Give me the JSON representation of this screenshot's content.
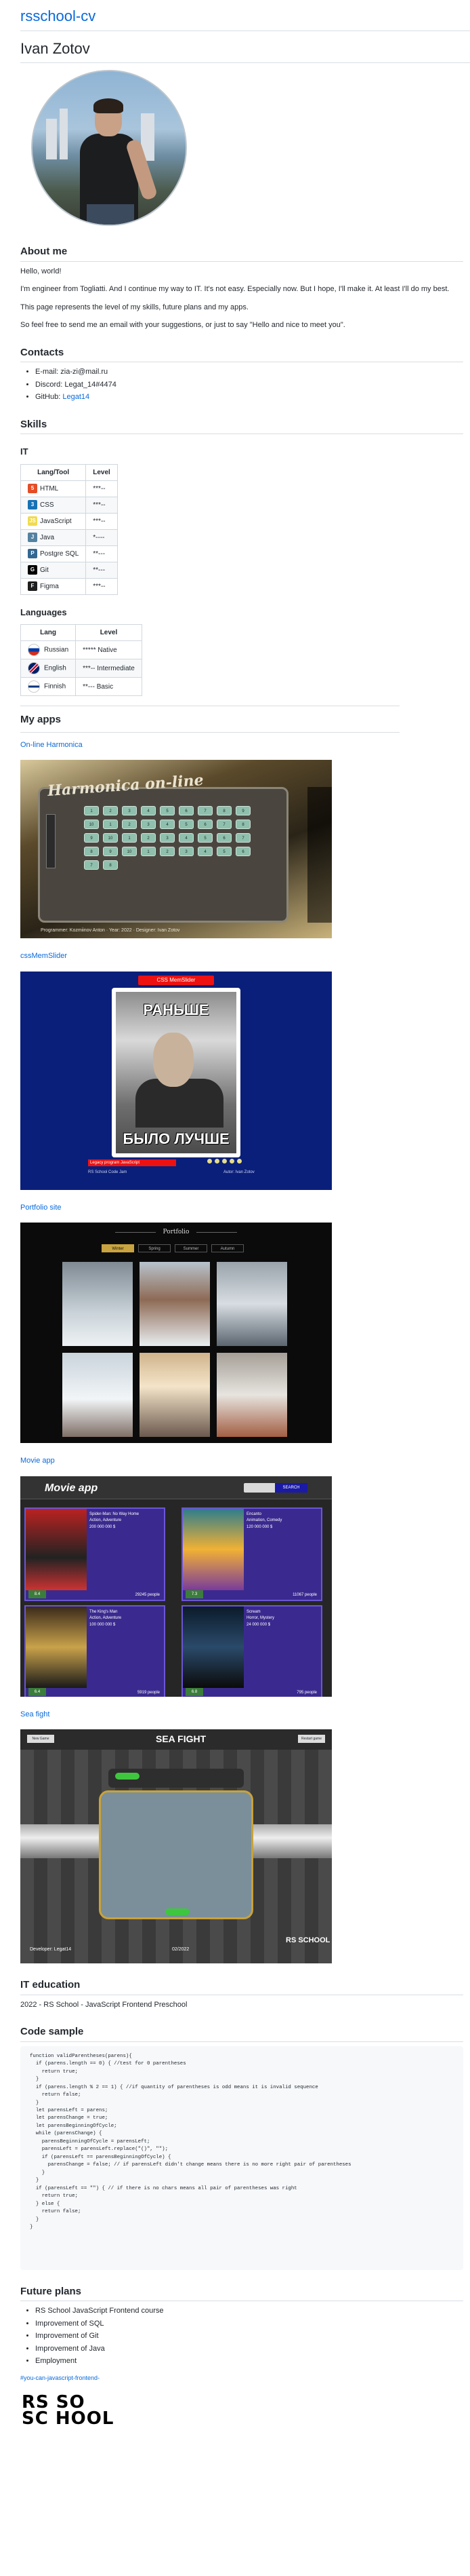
{
  "site": {
    "title": "rsschool-cv"
  },
  "name": "Ivan Zotov",
  "about": {
    "heading": "About me",
    "paragraphs": [
      "Hello, world!",
      "I'm engineer from Togliatti. And I continue my way to IT. It's not easy. Especially now. But I hope, I'll make it. At least I'll do my best.",
      "This page represents the level of my skills, future plans and my apps.",
      "So feel free to send me an email with your suggestions, or just to say \"Hello and nice to meet you\"."
    ]
  },
  "contacts": {
    "heading": "Contacts",
    "items": [
      {
        "label": "E-mail: ",
        "value": "zia-zi@mail.ru",
        "link": false
      },
      {
        "label": "Discord: ",
        "value": "Legat_14#4474",
        "link": false
      },
      {
        "label": "GitHub: ",
        "value": "Legat14",
        "link": true
      }
    ]
  },
  "skills": {
    "heading": "Skills",
    "it_heading": "IT",
    "it_columns": [
      "Lang/Tool",
      "Level"
    ],
    "it_rows": [
      {
        "icon": "html-icon",
        "color": "#e44d26",
        "glyph": "5",
        "name": "HTML",
        "level": "***--"
      },
      {
        "icon": "css-icon",
        "color": "#1572b6",
        "glyph": "3",
        "name": "CSS",
        "level": "***--"
      },
      {
        "icon": "javascript-icon",
        "color": "#f0db4f",
        "glyph": "JS",
        "name": "JavaScript",
        "level": "***--"
      },
      {
        "icon": "java-icon",
        "color": "#5382a1",
        "glyph": "J",
        "name": "Java",
        "level": "*----"
      },
      {
        "icon": "postgresql-icon",
        "color": "#336791",
        "glyph": "P",
        "name": "Postgre SQL",
        "level": "**---"
      },
      {
        "icon": "git-icon",
        "color": "#000000",
        "glyph": "G",
        "name": "Git",
        "level": "**---"
      },
      {
        "icon": "figma-icon",
        "color": "#1e1e1e",
        "glyph": "F",
        "name": "Figma",
        "level": "***--"
      }
    ],
    "languages_heading": "Languages",
    "lang_columns": [
      "Lang",
      "Level"
    ],
    "lang_rows": [
      {
        "icon": "russia-flag-icon",
        "name": "Russian",
        "level": "***** Native"
      },
      {
        "icon": "uk-flag-icon",
        "name": "English",
        "level": "***-- Intermediate"
      },
      {
        "icon": "finland-flag-icon",
        "name": "Finnish",
        "level": "**--- Basic"
      }
    ]
  },
  "apps": {
    "heading": "My apps",
    "harmonica": {
      "link": "On-line Harmonica",
      "title": "Harmonica on-line",
      "keys": [
        "1",
        "2",
        "3",
        "4",
        "5",
        "6",
        "7",
        "8",
        "9",
        "10",
        "1",
        "2",
        "3",
        "4",
        "5",
        "6",
        "7",
        "8",
        "9",
        "10",
        "1",
        "2",
        "3",
        "4",
        "5",
        "6",
        "7",
        "8",
        "9",
        "10",
        "1",
        "2",
        "3",
        "4",
        "5",
        "6",
        "7",
        "8"
      ],
      "footer": "Programmer: Kozmiinov Anton · Year: 2022 · Designer: Ivan Zotov"
    },
    "meme": {
      "link": "cssMemSlider",
      "pill": "CSS MemSlider",
      "top_text": "РАНЬШЕ",
      "bottom_text": "БЫЛО ЛУЧШЕ",
      "caption": "Legacy program JavaScript",
      "footer_left": "RS School Code Jam",
      "footer_right": "Autor: Ivan Zotov"
    },
    "portfolio": {
      "link": "Portfolio site",
      "title": "Portfolio",
      "tabs": [
        "Winter",
        "Spring",
        "Summer",
        "Autumn"
      ]
    },
    "movie": {
      "link": "Movie app",
      "logo": "Movie app",
      "search_btn": "SEARCH",
      "cards": [
        {
          "title": "Spider-Man: No Way Home",
          "genre": "Action, Adventure",
          "budget": "200 000 000 $",
          "rating": "8.4",
          "votes": "29245 people"
        },
        {
          "title": "Encanto",
          "genre": "Animation, Comedy",
          "budget": "120 000 000 $",
          "rating": "7.3",
          "votes": "11067 people"
        },
        {
          "title": "The King's Man",
          "genre": "Action, Adventure",
          "budget": "100 000 000 $",
          "rating": "6.4",
          "votes": "5919 people"
        },
        {
          "title": "Scream",
          "genre": "Horror, Mystery",
          "budget": "24 000 000 $",
          "rating": "6.8",
          "votes": "795 people"
        }
      ]
    },
    "seafight": {
      "link": "Sea fight",
      "logo": "SEA FIGHT",
      "developer": "Developer: Legat14",
      "date": "02/2022",
      "buttons": [
        "New Game",
        "Restart game"
      ],
      "rs": "RS SCHOOL"
    }
  },
  "education": {
    "heading": "IT education",
    "text": "2022 - RS School - JavaScript Frontend Preschool"
  },
  "code": {
    "heading": "Code sample",
    "text": "function validParentheses(parens){\n  if (parens.length == 0) { //test for 0 parentheses\n    return true;\n  }\n  if (parens.length % 2 == 1) { //if quantity of parentheses is odd means it is invalid sequence\n    return false;\n  }\n  let parensLeft = parens;\n  let parensChange = true;\n  let parensBeginningOfCycle;\n  while (parensChange) {\n    parensBeginningOfCycle = parensLeft;\n    parensLeft = parensLeft.replace(\"()\", \"\");\n    if (parensLeft == parensBeginningOfCycle) {\n      parensChange = false; // if parensLeft didn't change means there is no more right pair of parentheses\n    }\n  }\n  if (parensLeft == \"\") { // if there is no chars means all pair of parentheses was right\n    return true;\n  } else {\n    return false;\n  }\n}"
  },
  "plans": {
    "heading": "Future plans",
    "items": [
      "RS School JavaScript Frontend course",
      "Improvement of SQL",
      "Improvement of Git",
      "Improvement of Java",
      "Employment"
    ]
  },
  "footer": {
    "link": "#you-can-javascript-frontend-",
    "logo_line1": "RS SO",
    "logo_line2": "SC HOOL"
  }
}
